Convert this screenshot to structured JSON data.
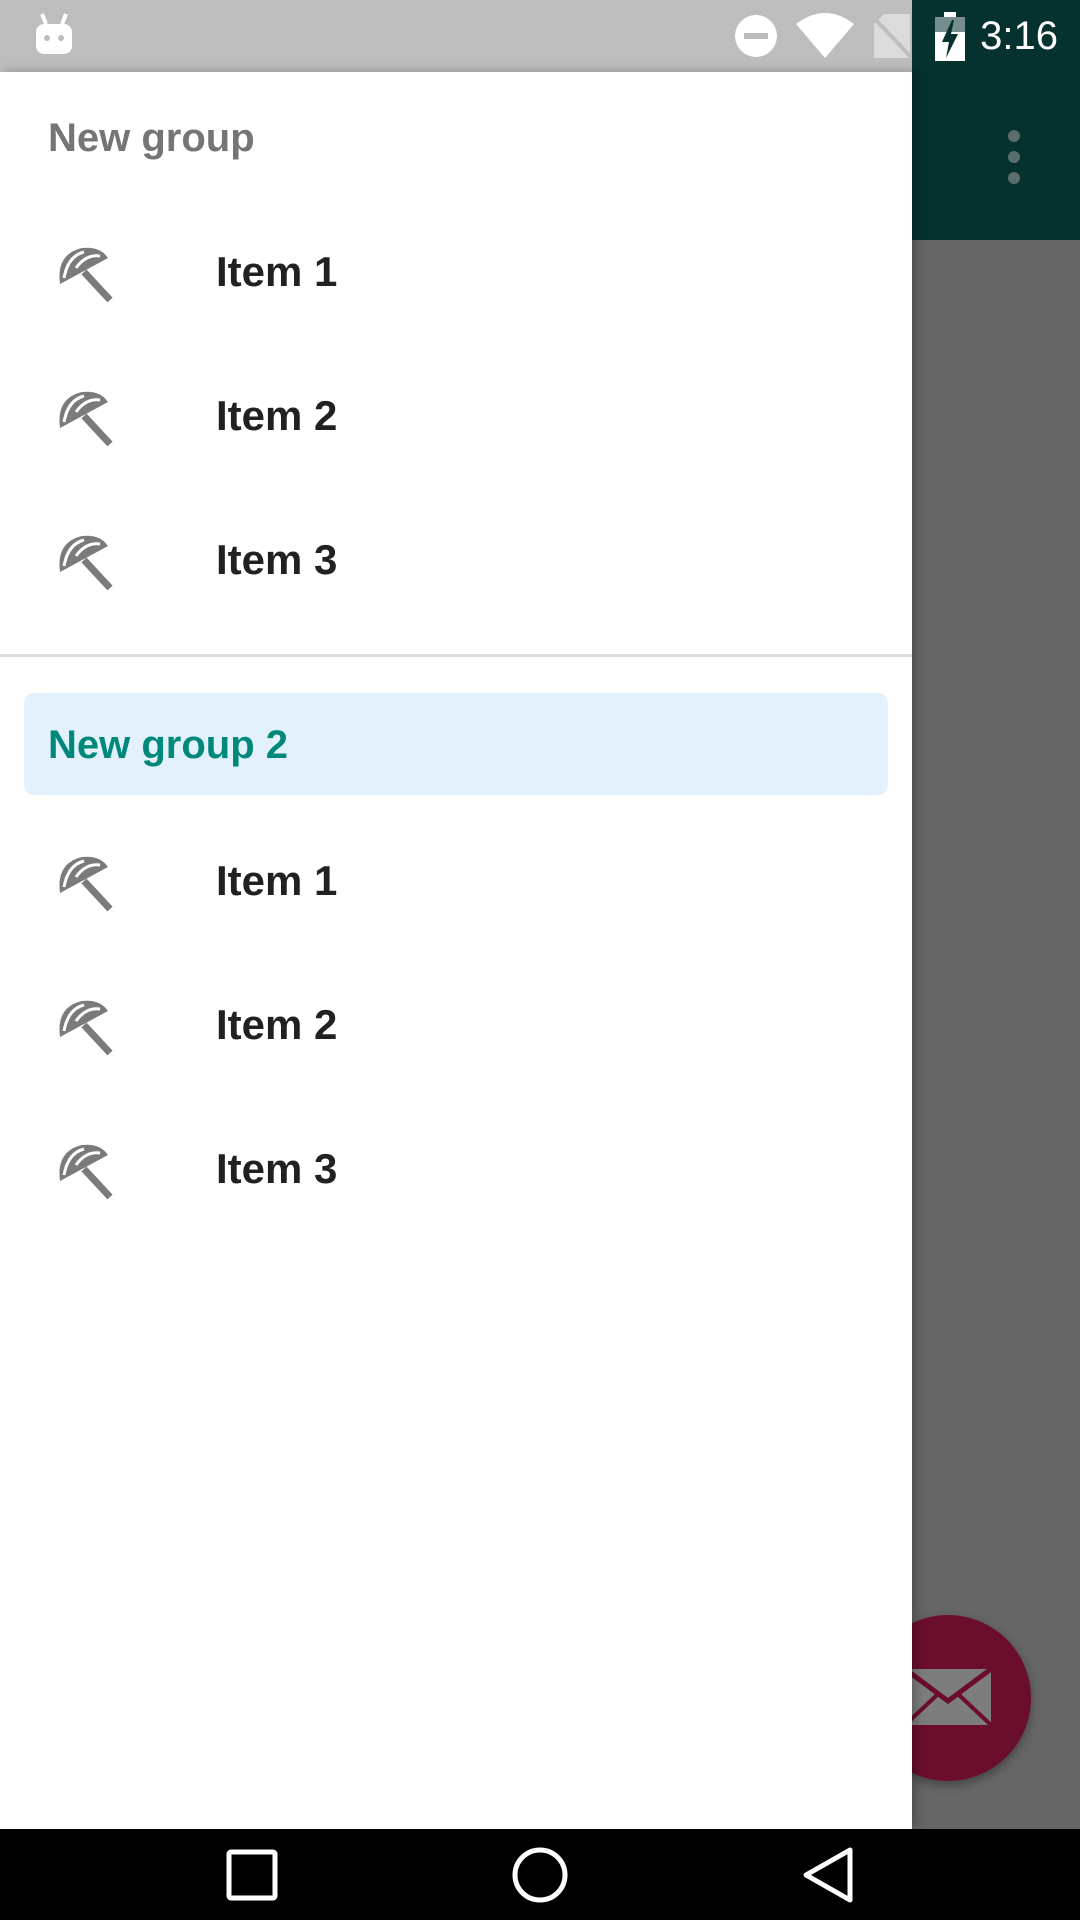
{
  "status_bar": {
    "time": "3:16",
    "icons": [
      "android-icon",
      "do-not-disturb-icon",
      "wifi-icon",
      "no-sim-icon",
      "battery-charging-icon"
    ]
  },
  "app": {
    "toolbar_color": "#05312e",
    "overflow_icon": "more-vert-icon",
    "fab_icon": "email-icon",
    "fab_color": "#6b0e2c"
  },
  "drawer": {
    "group1": {
      "title": "New group",
      "items": [
        {
          "label": "Item 1",
          "icon": "beach-umbrella-icon"
        },
        {
          "label": "Item 2",
          "icon": "beach-umbrella-icon"
        },
        {
          "label": "Item 3",
          "icon": "beach-umbrella-icon"
        }
      ]
    },
    "group2": {
      "title": "New group 2",
      "highlight_color": "#e3f1fc",
      "title_color": "#00897b",
      "items": [
        {
          "label": "Item 1",
          "icon": "beach-umbrella-icon"
        },
        {
          "label": "Item 2",
          "icon": "beach-umbrella-icon"
        },
        {
          "label": "Item 3",
          "icon": "beach-umbrella-icon"
        }
      ]
    }
  },
  "nav_bar": {
    "buttons": [
      "recents-icon",
      "home-icon",
      "back-icon"
    ]
  }
}
